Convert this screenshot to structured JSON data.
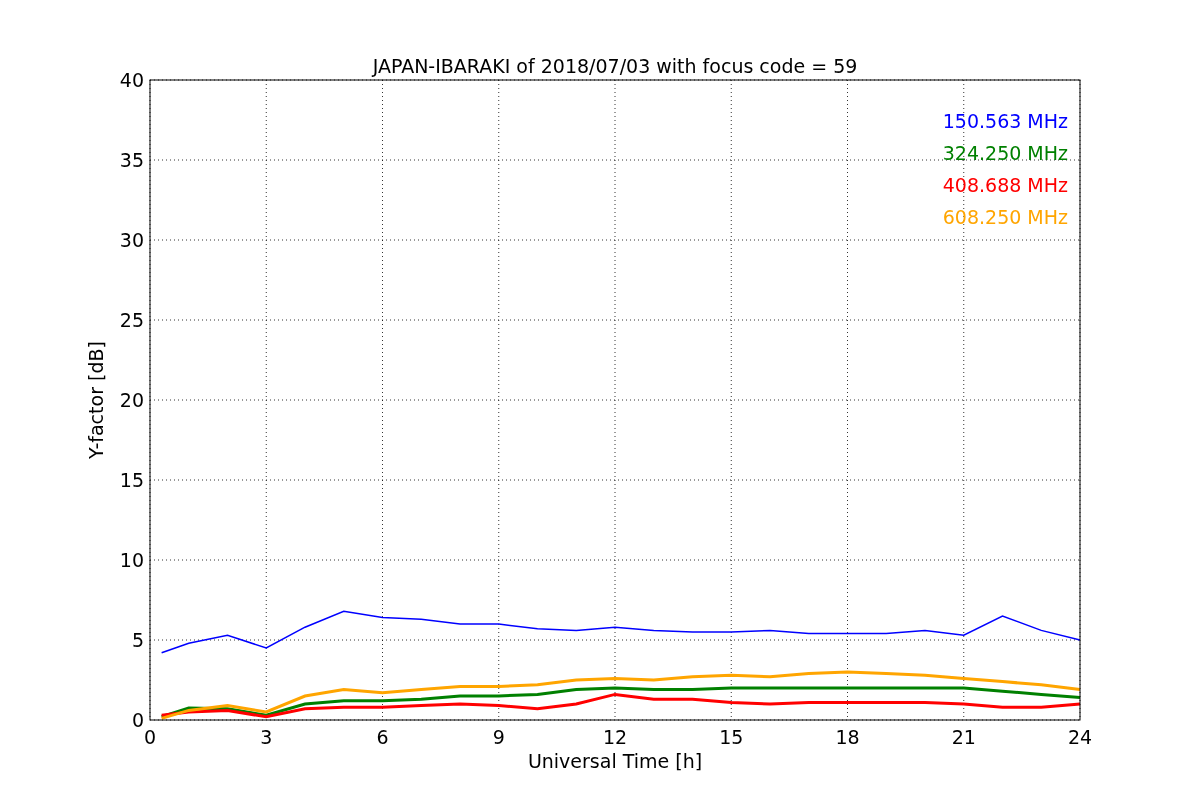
{
  "chart_data": {
    "type": "line",
    "title": "JAPAN-IBARAKI of 2018/07/03 with focus code = 59",
    "xlabel": "Universal Time [h]",
    "ylabel": "Y-factor [dB]",
    "x": [
      0.3,
      1,
      2,
      3,
      4,
      5,
      6,
      7,
      8,
      9,
      10,
      11,
      12,
      13,
      14,
      15,
      16,
      17,
      18,
      19,
      20,
      21,
      22,
      23,
      24
    ],
    "series": [
      {
        "name": "150.563 MHz",
        "color": "#0000ff",
        "values": [
          4.2,
          4.8,
          5.3,
          4.5,
          5.8,
          6.8,
          6.4,
          6.3,
          6.0,
          6.0,
          5.7,
          5.6,
          5.8,
          5.6,
          5.5,
          5.5,
          5.6,
          5.4,
          5.4,
          5.4,
          5.6,
          5.3,
          6.5,
          5.6,
          5.0
        ]
      },
      {
        "name": "324.250 MHz",
        "color": "#008000",
        "values": [
          0.2,
          0.75,
          0.7,
          0.3,
          1.0,
          1.2,
          1.2,
          1.3,
          1.5,
          1.5,
          1.6,
          1.9,
          2.0,
          1.9,
          1.9,
          2.0,
          2.0,
          2.0,
          2.0,
          2.0,
          2.0,
          2.0,
          1.8,
          1.6,
          1.4
        ]
      },
      {
        "name": "408.688 MHz",
        "color": "#ff0000",
        "values": [
          0.3,
          0.5,
          0.6,
          0.2,
          0.7,
          0.8,
          0.8,
          0.9,
          1.0,
          0.9,
          0.7,
          1.0,
          1.6,
          1.3,
          1.3,
          1.1,
          1.0,
          1.1,
          1.1,
          1.1,
          1.1,
          1.0,
          0.8,
          0.8,
          1.0
        ]
      },
      {
        "name": "608.250 MHz",
        "color": "#ffa500",
        "values": [
          0.1,
          0.6,
          0.9,
          0.5,
          1.5,
          1.9,
          1.7,
          1.9,
          2.1,
          2.1,
          2.2,
          2.5,
          2.6,
          2.5,
          2.7,
          2.8,
          2.7,
          2.9,
          3.0,
          2.9,
          2.8,
          2.6,
          2.4,
          2.2,
          1.9
        ]
      }
    ],
    "xlim": [
      0,
      24
    ],
    "ylim": [
      0,
      40
    ],
    "xticks": [
      0,
      3,
      6,
      9,
      12,
      15,
      18,
      21,
      24
    ],
    "yticks": [
      0,
      5,
      10,
      15,
      20,
      25,
      30,
      35,
      40
    ],
    "grid": true
  }
}
